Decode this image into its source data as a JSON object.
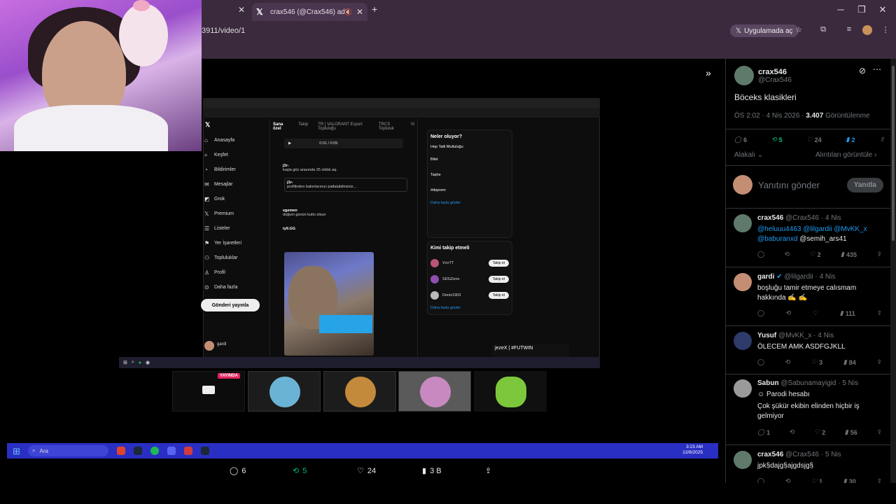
{
  "browser": {
    "tab_label": "crax546 (@Crax546) adlı kulla...",
    "url_text": "3911/video/1",
    "open_in_app": "Uygulamada aç"
  },
  "mini_x": {
    "nav": [
      "Anasayfa",
      "Keşfet",
      "Bildirimler",
      "Mesajlar",
      "Grok",
      "Premium",
      "Listeler",
      "Yer İşaretleri",
      "Topluluklar",
      "Profil",
      "Daha fazla"
    ],
    "post_button": "Gönderi yayınla",
    "tabs": [
      "Sana özel",
      "Takip",
      "TR | VALORANT Esport Topluluğu",
      "TRCS Topluluk",
      "Vi"
    ],
    "player_time": "0:01 / 0:09",
    "posts": [
      {
        "author": "j3r-",
        "text": "kaşla göz arasında 25 oldük aq."
      },
      {
        "author": "j3r-",
        "text": "profilinden balonlarınızı patlatabilirsiniz..."
      },
      {
        "author": "egemen",
        "text": "doğum günün kutlu olsun"
      },
      {
        "author": "ty9.GG",
        "text": ""
      }
    ],
    "trending_title": "Neler oluyor?",
    "trending": [
      "Hep Tatil Mutluluğu",
      "Bilet",
      "Taşhe",
      "#deprem"
    ],
    "show_more": "Daha fazla göster",
    "follow_title": "Kimi takip etmeli",
    "follow": [
      {
        "name": "VcnTT",
        "button": "Takip et"
      },
      {
        "name": "SDGZeno",
        "button": "Takip et"
      },
      {
        "name": "Deniz1903",
        "button": "Takip et"
      }
    ],
    "toast": "jezeX | #FUTWIN",
    "bottom_user": "gardi"
  },
  "thumbs": {
    "live_badge": "YAYINDA"
  },
  "taskbar": {
    "search": "Ara",
    "time": "3:23 AM",
    "date": "12/8/2025"
  },
  "video_actions": {
    "replies": "6",
    "reposts": "5",
    "likes": "24",
    "views": "3 B"
  },
  "post": {
    "display_name": "crax546",
    "handle": "@Crax546",
    "text": "Böceks klasikleri",
    "timestamp": "ÖS 2:02 · 4 Nis 2026 · ",
    "views_count": "3.407",
    "views_label": " Görüntülenme",
    "replies": "6",
    "reposts": "5",
    "likes": "24",
    "bookmarks": "2",
    "sort_label": "Alakalı",
    "quotes_link": "Alıntıları görüntüle"
  },
  "compose": {
    "placeholder": "Yanıtını gönder",
    "button": "Yanıtla"
  },
  "replies": [
    {
      "name": "crax546",
      "handle": "@Crax546 · 4 Nis",
      "mentions": "@heluuu4463 @lilgardii @MvKK_x @baburanxd",
      "text": " @semih_ars41",
      "replies": "",
      "reposts": "",
      "likes": "2",
      "views": "435"
    },
    {
      "name": "gardi",
      "handle": "@lilgardii · 4 Nis",
      "mentions": "",
      "text": "boşluğu tamir etmeye calısmam hakkında ✍️ ✍️",
      "replies": "",
      "reposts": "",
      "likes": "",
      "views": "111"
    },
    {
      "name": "Yusuf",
      "handle": "@MvKK_x · 4 Nis",
      "mentions": "",
      "text": "ÖLECEM AMK ASDFGJKLL",
      "replies": "",
      "reposts": "",
      "likes": "3",
      "views": "84"
    },
    {
      "name": "Sabun",
      "handle": "@Sabunamayigid · 5 Nis",
      "parody": "Parodi hesabı",
      "mentions": "",
      "text": "Çok şükür ekibin elinden hiçbir iş gelmiyor",
      "replies": "1",
      "reposts": "",
      "likes": "2",
      "views": "56"
    },
    {
      "name": "crax546",
      "handle": "@Crax546 · 5 Nis",
      "mentions": "",
      "text": "jpk§dajg§ajgdsjg§",
      "replies": "",
      "reposts": "",
      "likes": "1",
      "views": "30"
    }
  ],
  "colors": {
    "accent_blue": "#1d9bf0",
    "repost_green": "#00ba7c",
    "taskbar_blue": "#2a2fc4",
    "chrome_bg": "#3b2a3e"
  }
}
